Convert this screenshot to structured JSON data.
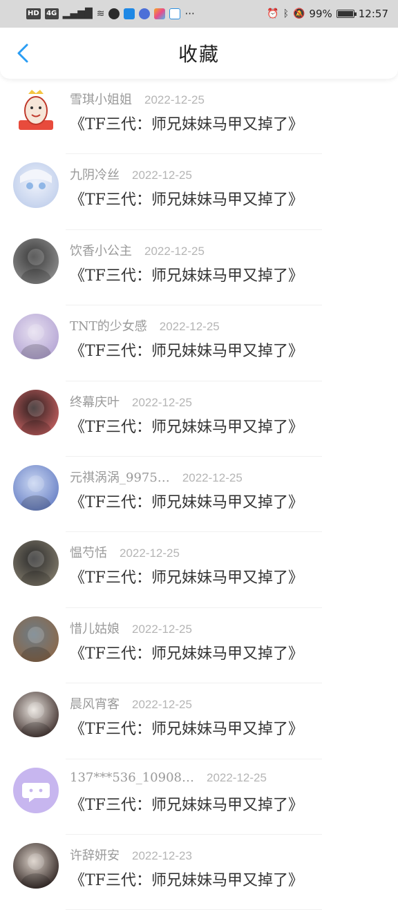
{
  "status_bar": {
    "left_badges": [
      "HD",
      "4G"
    ],
    "battery": "99%",
    "time": "12:57",
    "dots": "···"
  },
  "header": {
    "title": "收藏"
  },
  "items": [
    {
      "name": "雪琪小姐姐",
      "date": "2022-12-25",
      "book": "《TF三代：师兄妹妹马甲又掉了》",
      "avatar": "cartoon",
      "colors": [
        "#f6e6d8",
        "#e84b3c"
      ]
    },
    {
      "name": "九阴冷丝",
      "date": "2022-12-25",
      "book": "《TF三代：师兄妹妹马甲又掉了》",
      "avatar": "anime",
      "colors": [
        "#eef2fb",
        "#b6c7e8"
      ]
    },
    {
      "name": "饮香小公主",
      "date": "2022-12-25",
      "book": "《TF三代：师兄妹妹马甲又掉了》",
      "avatar": "photo",
      "colors": [
        "#3a3a3a",
        "#888888"
      ]
    },
    {
      "name": "TNT的少女感",
      "date": "2022-12-25",
      "book": "《TF三代：师兄妹妹马甲又掉了》",
      "avatar": "photo",
      "colors": [
        "#e6dff0",
        "#b8a9d6"
      ]
    },
    {
      "name": "终幕庆叶",
      "date": "2022-12-25",
      "book": "《TF三代：师兄妹妹马甲又掉了》",
      "avatar": "photo",
      "colors": [
        "#2a1e1e",
        "#b85b5b"
      ]
    },
    {
      "name": "元祺涡涡_9975…",
      "date": "2022-12-25",
      "book": "《TF三代：师兄妹妹马甲又掉了》",
      "avatar": "photo",
      "colors": [
        "#c9d6f2",
        "#6f86c8"
      ]
    },
    {
      "name": "愠芍恬",
      "date": "2022-12-25",
      "book": "《TF三代：师兄妹妹马甲又掉了》",
      "avatar": "photo",
      "colors": [
        "#2b2b2b",
        "#7a7466"
      ]
    },
    {
      "name": "惜儿姑娘",
      "date": "2022-12-25",
      "book": "《TF三代：师兄妹妹马甲又掉了》",
      "avatar": "photo",
      "colors": [
        "#6d7c86",
        "#8a6a4e"
      ]
    },
    {
      "name": "晨风宵客",
      "date": "2022-12-25",
      "book": "《TF三代：师兄妹妹马甲又掉了》",
      "avatar": "photo",
      "colors": [
        "#e9e4de",
        "#4b3c39"
      ]
    },
    {
      "name": "137***536_10908…",
      "date": "2022-12-25",
      "book": "《TF三代：师兄妹妹马甲又掉了》",
      "avatar": "chat",
      "colors": [
        "#c7b6ef",
        "#ffffff"
      ]
    },
    {
      "name": "许辞妍安",
      "date": "2022-12-23",
      "book": "《TF三代：师兄妹妹马甲又掉了》",
      "avatar": "photo",
      "colors": [
        "#d9cfc6",
        "#3a2f2c"
      ]
    }
  ]
}
